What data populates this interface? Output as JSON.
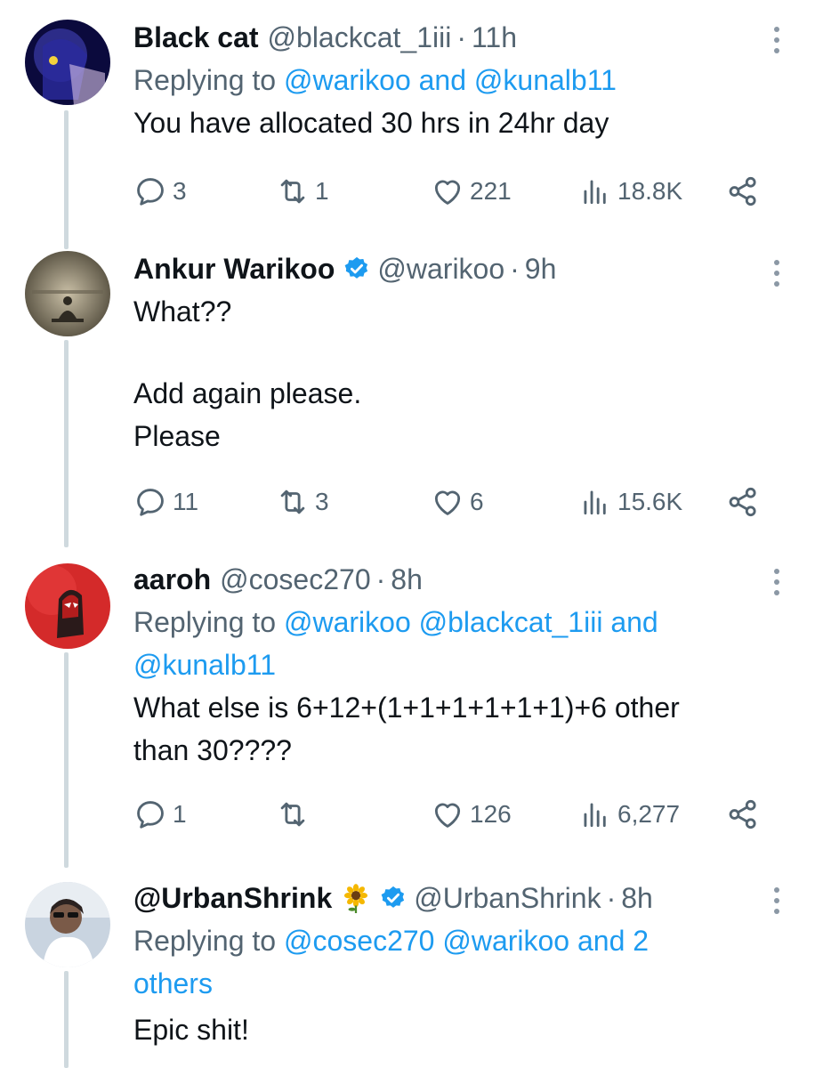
{
  "tweets": [
    {
      "name": "Black cat",
      "handle": "@blackcat_1iii",
      "time": "11h",
      "replying_label": "Replying to",
      "replying_mentions": [
        "@warikoo",
        "@kunalb11"
      ],
      "body_lines": [
        "You have allocated 30 hrs in 24hr day"
      ],
      "stats": {
        "replies": "3",
        "retweets": "1",
        "likes": "221",
        "views": "18.8K"
      }
    },
    {
      "name": "Ankur Warikoo",
      "handle": "@warikoo",
      "time": "9h",
      "verified": true,
      "body_lines": [
        "What??",
        "",
        "Add again please.",
        "Please"
      ],
      "stats": {
        "replies": "11",
        "retweets": "3",
        "likes": "6",
        "views": "15.6K"
      }
    },
    {
      "name": "aaroh",
      "handle": "@cosec270",
      "time": "8h",
      "replying_label": "Replying to",
      "replying_line1": "@warikoo @blackcat_1iii",
      "replying_and": "and",
      "replying_line2": "@kunalb11",
      "body_lines": [
        "What else is 6+12+(1+1+1+1+1+1)+6 other",
        "than 30????"
      ],
      "stats": {
        "replies": "1",
        "retweets": "",
        "likes": "126",
        "views": "6,277"
      }
    },
    {
      "name": "@UrbanShrink",
      "handle": "@UrbanShrink",
      "time": "8h",
      "verified": true,
      "emoji": "sunflower-icon",
      "replying_label": "Replying to",
      "replying_line1": "@cosec270 @warikoo and 2",
      "replying_line2": "others",
      "body_lines": [
        "Epic shit!"
      ]
    }
  ],
  "middot": "·",
  "colors": {
    "accent": "#1d9bf0",
    "secondary_text": "#536471",
    "thread_line": "#cfd9de"
  }
}
